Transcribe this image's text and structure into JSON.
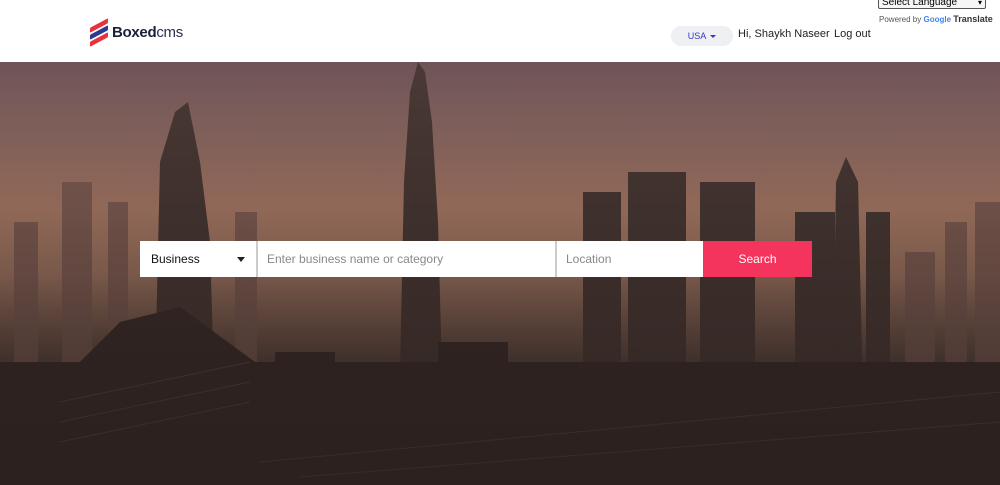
{
  "header": {
    "logo_text_bold": "Boxed",
    "logo_text_light": "cms",
    "language_select": "Select Language",
    "powered_by_prefix": "Powered by",
    "powered_by_brand": "Google",
    "powered_by_suffix": "Translate",
    "country": "USA",
    "greeting": "Hi, Shaykh Naseer",
    "logout": "Log out"
  },
  "search": {
    "category": "Business",
    "name_placeholder": "Enter business name or category",
    "location_placeholder": "Location",
    "button_label": "Search",
    "button_icon": "search-icon"
  },
  "colors": {
    "accent": "#f4345c",
    "country_text": "#3a34c4",
    "logo_red": "#e8323c",
    "logo_blue": "#2a3a8f"
  }
}
